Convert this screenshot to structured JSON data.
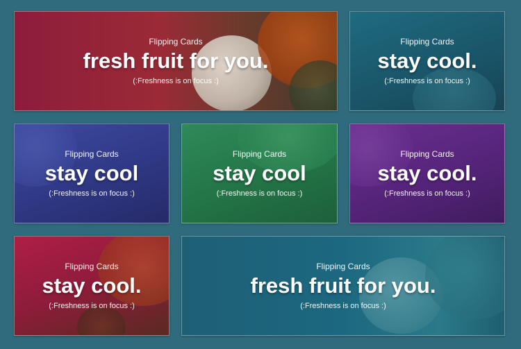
{
  "cards": [
    {
      "eyebrow": "Flipping Cards",
      "headline": "fresh fruit for you.",
      "sub": "(:Freshness is on focus :)"
    },
    {
      "eyebrow": "Flipping Cards",
      "headline": "stay cool.",
      "sub": "(:Freshness is on focus :)"
    },
    {
      "eyebrow": "Flipping Cards",
      "headline": "stay cool",
      "sub": "(:Freshness is on focus :)"
    },
    {
      "eyebrow": "Flipping Cards",
      "headline": "stay cool",
      "sub": "(:Freshness is on focus :)"
    },
    {
      "eyebrow": "Flipping Cards",
      "headline": "stay cool.",
      "sub": "(:Freshness is on focus :)"
    },
    {
      "eyebrow": "Flipping Cards",
      "headline": "stay cool.",
      "sub": "(:Freshness is on focus :)"
    },
    {
      "eyebrow": "Flipping Cards",
      "headline": "fresh fruit for you.",
      "sub": "(:Freshness is on focus :)"
    }
  ],
  "colors": {
    "page_background": "#2f6b7c",
    "red": "#8d1c3c",
    "teal": "#1f6b80",
    "indigo": "#2f3884",
    "green": "#237446",
    "purple": "#55247a",
    "crimson": "#b01e45"
  }
}
